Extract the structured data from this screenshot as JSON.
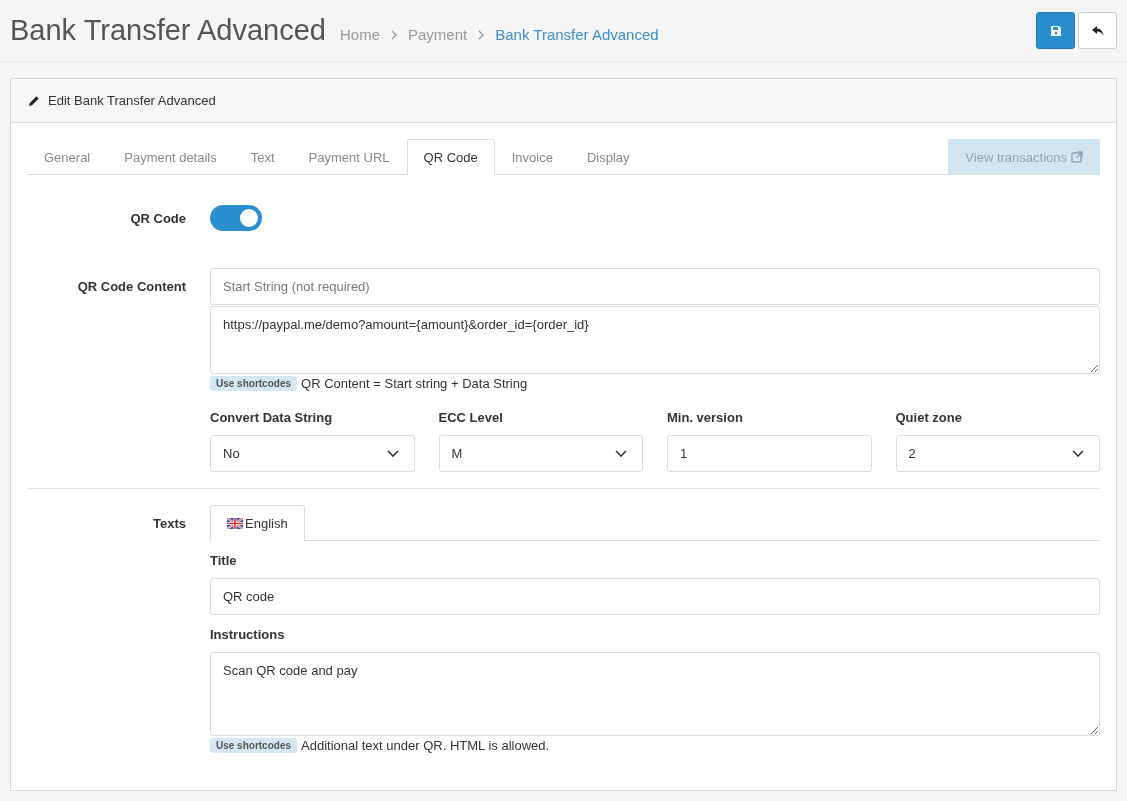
{
  "page_header": {
    "title": "Bank Transfer Advanced",
    "breadcrumb": [
      {
        "label": "Home",
        "current": false
      },
      {
        "label": "Payment",
        "current": false
      },
      {
        "label": "Bank Transfer Advanced",
        "current": true
      }
    ],
    "buttons": [
      {
        "kind": "save"
      },
      {
        "kind": "back"
      }
    ]
  },
  "panel": {
    "heading": "Edit Bank Transfer Advanced",
    "tabs": [
      {
        "label": "General",
        "selected": false
      },
      {
        "label": "Payment details",
        "selected": false
      },
      {
        "label": "Text",
        "selected": false
      },
      {
        "label": "Payment URL",
        "selected": false
      },
      {
        "label": "QR Code",
        "selected": true
      },
      {
        "label": "Invoice",
        "selected": false
      },
      {
        "label": "Display",
        "selected": false
      }
    ],
    "view_transactions": {
      "label": "View transactions",
      "disabled": true
    },
    "qr_code": {
      "label": "QR Code",
      "on": true
    },
    "content": {
      "label": "QR Code Content",
      "start_string": {
        "placeholder": "Start String (not required)"
      },
      "data_string": {
        "value": "https://paypal.me/demo?amount={amount}&order_id={order_id}"
      },
      "badge": "Use shortcodes",
      "help": "QR Content = Start string + Data String"
    },
    "options": [
      {
        "label": "Convert Data String",
        "kind": "select",
        "value": "No"
      },
      {
        "label": "ECC Level",
        "kind": "select",
        "value": "M"
      },
      {
        "label": "Min. version",
        "kind": "input",
        "value": "1"
      },
      {
        "label": "Quiet zone",
        "kind": "select",
        "value": "2"
      }
    ],
    "texts": {
      "label": "Texts",
      "languages": [
        {
          "label": "English",
          "selected": true
        }
      ],
      "title_label": "Title",
      "title_value": "QR code",
      "instructions_label": "Instructions",
      "instructions_value": "Scan QR code and pay",
      "badge": "Use shortcodes",
      "help": "Additional text under QR. HTML is allowed."
    }
  }
}
